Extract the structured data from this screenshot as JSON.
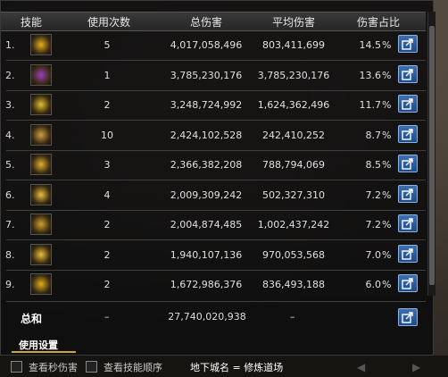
{
  "header": {
    "skill": "技能",
    "uses": "使用次数",
    "total": "总伤害",
    "avg": "平均伤害",
    "pct": "伤害占比"
  },
  "rows": [
    {
      "num": "1.",
      "uses": "5",
      "total": "4,017,058,496",
      "avg": "803,411,699",
      "pct": "14.5",
      "pct_sign": "%",
      "icon": "flame-skill-icon",
      "color": "#e8b020"
    },
    {
      "num": "2.",
      "uses": "1",
      "total": "3,785,230,176",
      "avg": "3,785,230,176",
      "pct": "13.6",
      "pct_sign": "%",
      "icon": "purple-burst-skill-icon",
      "color": "#9a40c0"
    },
    {
      "num": "3.",
      "uses": "2",
      "total": "3,248,724,992",
      "avg": "1,624,362,496",
      "pct": "11.7",
      "pct_sign": "%",
      "icon": "light-spear-skill-icon",
      "color": "#e0c030"
    },
    {
      "num": "4.",
      "uses": "10",
      "total": "2,424,102,528",
      "avg": "242,410,252",
      "pct": "8.7",
      "pct_sign": "%",
      "icon": "club-skill-icon",
      "color": "#d0a040"
    },
    {
      "num": "5.",
      "uses": "3",
      "total": "2,366,382,208",
      "avg": "788,794,069",
      "pct": "8.5",
      "pct_sign": "%",
      "icon": "strike-skill-icon",
      "color": "#e0b030"
    },
    {
      "num": "6.",
      "uses": "4",
      "total": "2,009,309,242",
      "avg": "502,327,310",
      "pct": "7.2",
      "pct_sign": "%",
      "icon": "multi-slash-skill-icon",
      "color": "#e8c040"
    },
    {
      "num": "7.",
      "uses": "2",
      "total": "2,004,874,485",
      "avg": "1,002,437,242",
      "pct": "7.2",
      "pct_sign": "%",
      "icon": "ring-skill-icon",
      "color": "#d0a030"
    },
    {
      "num": "8.",
      "uses": "2",
      "total": "1,940,107,136",
      "avg": "970,053,568",
      "pct": "7.0",
      "pct_sign": "%",
      "icon": "star-burst-skill-icon",
      "color": "#e8c040"
    },
    {
      "num": "9.",
      "uses": "2",
      "total": "1,672,986,376",
      "avg": "836,493,188",
      "pct": "6.0",
      "pct_sign": "%",
      "icon": "crescent-slash-skill-icon",
      "color": "#e0b020"
    }
  ],
  "summary": {
    "label": "总和",
    "uses": "–",
    "total": "27,740,020,938",
    "avg": "–"
  },
  "settings_label": "使用设置",
  "bottom": {
    "check1": "查看秒伤害",
    "check2": "查看技能顺序",
    "map": "地下城名 = 修炼道场",
    "arrow_left": "◀",
    "arrow_right": "▶"
  }
}
